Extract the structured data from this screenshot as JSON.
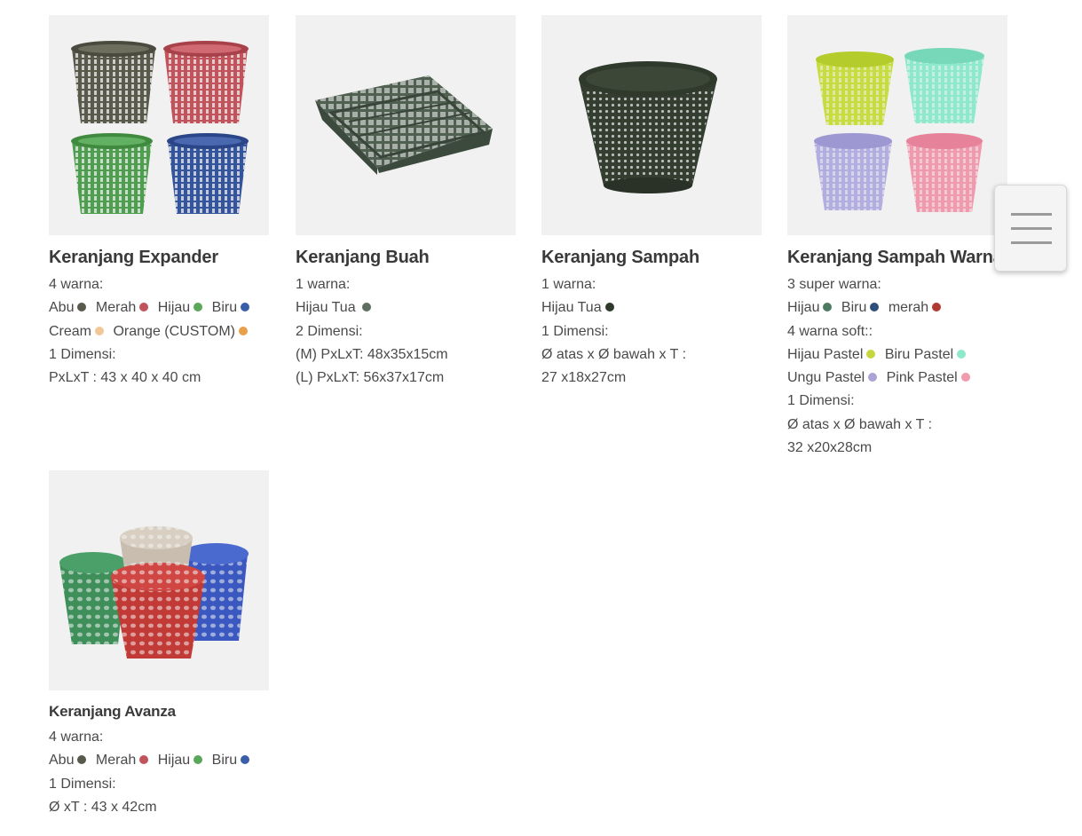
{
  "products": [
    {
      "title": "Keranjang Expander",
      "lines": [
        {
          "segments": [
            {
              "text": "4 warna:"
            }
          ]
        },
        {
          "segments": [
            {
              "text": "Abu",
              "dot": "#5a5a4c"
            },
            {
              "text": "Merah",
              "dot": "#c0535c"
            },
            {
              "text": "Hijau",
              "dot": "#5aa75a"
            },
            {
              "text": "Biru",
              "dot": "#3a5fa8"
            }
          ]
        },
        {
          "segments": [
            {
              "text": "Cream",
              "dot": "#f2c896"
            },
            {
              "text": "Orange (CUSTOM)",
              "dot": "#e8a04a"
            }
          ]
        },
        {
          "segments": [
            {
              "text": "1 Dimensi:"
            }
          ]
        },
        {
          "segments": [
            {
              "text": "PxLxT : 43 x 40 x 40 cm"
            }
          ]
        }
      ]
    },
    {
      "title": "Keranjang Buah",
      "lines": [
        {
          "segments": [
            {
              "text": "1 warna:"
            }
          ]
        },
        {
          "segments": [
            {
              "text": "Hijau Tua",
              "dot": "#5e6e60"
            }
          ]
        },
        {
          "segments": [
            {
              "text": "2 Dimensi:"
            }
          ]
        },
        {
          "segments": [
            {
              "text": "(M) PxLxT: 48x35x15cm"
            }
          ]
        },
        {
          "segments": [
            {
              "text": "(L) PxLxT: 56x37x17cm"
            }
          ]
        }
      ]
    },
    {
      "title": "Keranjang Sampah",
      "lines": [
        {
          "segments": [
            {
              "text": "1 warna:"
            }
          ]
        },
        {
          "segments": [
            {
              "text": "Hijau Tua",
              "dot": "#2f3a2c"
            }
          ]
        },
        {
          "segments": [
            {
              "text": "1 Dimensi:"
            }
          ]
        },
        {
          "segments": [
            {
              "text": "Ø atas x Ø bawah x T :"
            }
          ]
        },
        {
          "segments": [
            {
              "text": "27 x18x27cm"
            }
          ]
        }
      ]
    },
    {
      "title": "Keranjang Sampah Warna",
      "lines": [
        {
          "segments": [
            {
              "text": "3 super warna:"
            }
          ]
        },
        {
          "segments": [
            {
              "text": "Hijau",
              "dot": "#4f7a62"
            },
            {
              "text": "Biru",
              "dot": "#2f4f7a"
            },
            {
              "text": "merah",
              "dot": "#b03a30"
            }
          ]
        },
        {
          "segments": [
            {
              "text": "4 warna soft::"
            }
          ]
        },
        {
          "segments": [
            {
              "text": "Hijau Pastel",
              "dot": "#c6d63e"
            },
            {
              "text": "Biru Pastel",
              "dot": "#8ee8cc"
            }
          ]
        },
        {
          "segments": [
            {
              "text": "Ungu Pastel",
              "dot": "#a9a3d6"
            },
            {
              "text": "Pink Pastel",
              "dot": "#f09aae"
            }
          ]
        },
        {
          "segments": [
            {
              "text": "1 Dimensi:"
            }
          ]
        },
        {
          "segments": [
            {
              "text": "Ø atas x Ø bawah x T :"
            }
          ]
        },
        {
          "segments": [
            {
              "text": "32 x20x28cm"
            }
          ]
        }
      ]
    },
    {
      "title": "Keranjang Avanza",
      "lines": [
        {
          "segments": [
            {
              "text": "4 warna:"
            }
          ]
        },
        {
          "segments": [
            {
              "text": "Abu",
              "dot": "#5a5a4c"
            },
            {
              "text": "Merah",
              "dot": "#c0535c"
            },
            {
              "text": "Hijau",
              "dot": "#5aa75a"
            },
            {
              "text": "Biru",
              "dot": "#3a5fa8"
            }
          ]
        },
        {
          "segments": [
            {
              "text": "1 Dimensi:"
            }
          ]
        },
        {
          "segments": [
            {
              "text": "Ø xT : 43 x 42cm"
            }
          ]
        }
      ]
    }
  ],
  "menu_button": {
    "icon": "hamburger-menu-icon"
  }
}
